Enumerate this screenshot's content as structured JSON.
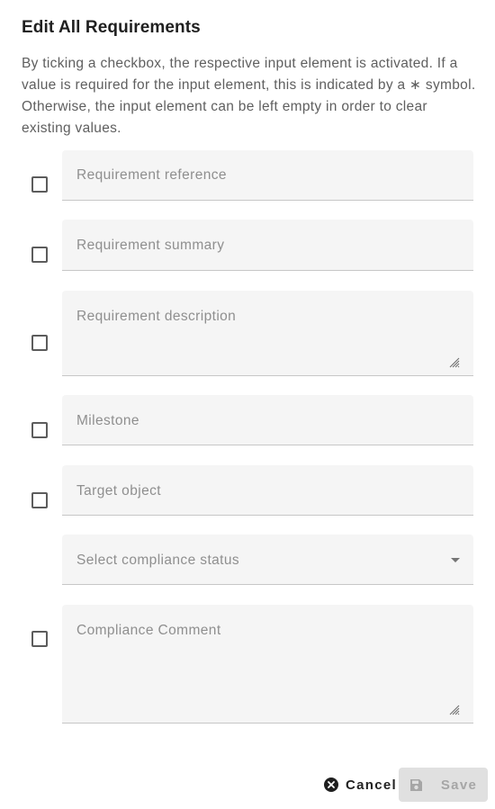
{
  "dialog": {
    "title": "Edit All Requirements",
    "description": "By ticking a checkbox, the respective input element is activated. If a value is required for the input element, this is indicated by a ∗ symbol. Otherwise, the input element can be left empty in order to clear existing values."
  },
  "fields": {
    "reference": {
      "placeholder": "Requirement reference",
      "checked": false
    },
    "summary": {
      "placeholder": "Requirement summary",
      "checked": false
    },
    "description": {
      "placeholder": "Requirement description",
      "checked": false
    },
    "milestone": {
      "placeholder": "Milestone",
      "checked": false
    },
    "target_object": {
      "placeholder": "Target object",
      "checked": false
    },
    "compliance_status": {
      "placeholder": "Select compliance status",
      "icon": "dropdown-caret-icon"
    },
    "compliance_comment": {
      "placeholder": "Compliance Comment",
      "checked": false
    }
  },
  "actions": {
    "cancel_label": "Cancel",
    "cancel_icon": "cancel-circle-icon",
    "save_label": "Save",
    "save_icon": "floppy-disk-icon",
    "save_enabled": false
  }
}
